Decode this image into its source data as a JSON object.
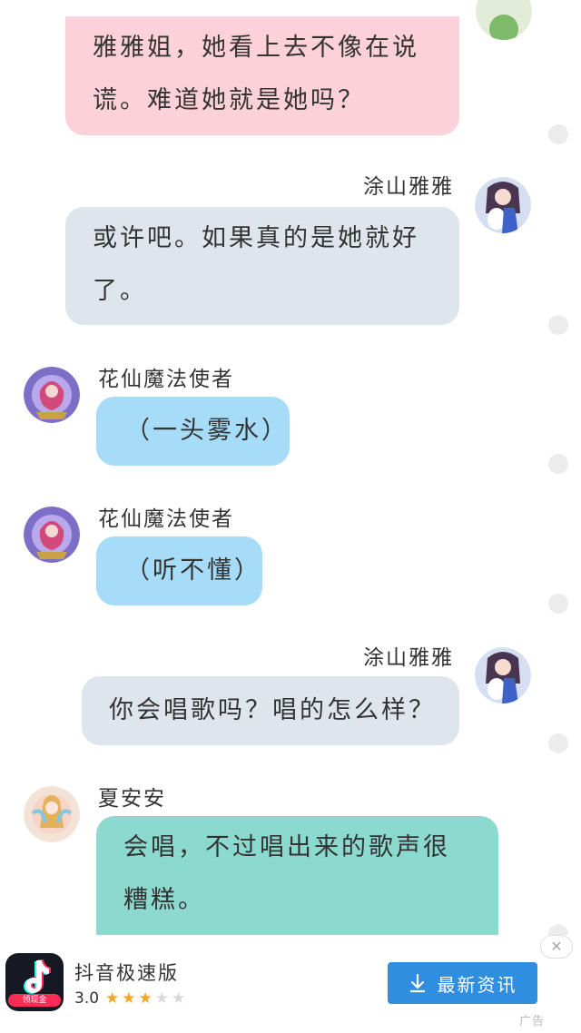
{
  "messages": [
    {
      "lines": [
        "雅雅姐，她看上去不像在说",
        "谎。难道她就是她吗？"
      ]
    },
    {
      "name": "涂山雅雅",
      "lines": [
        "或许吧。如果真的是她就好",
        "了。"
      ]
    },
    {
      "name": "花仙魔法使者",
      "lines": [
        "（一头雾水）"
      ]
    },
    {
      "name": "花仙魔法使者",
      "lines": [
        "（听不懂）"
      ]
    },
    {
      "name": "涂山雅雅",
      "lines": [
        "你会唱歌吗？唱的怎么样？"
      ]
    },
    {
      "name": "夏安安",
      "lines": [
        "会唱，不过唱出来的歌声很",
        "糟糕。"
      ]
    }
  ],
  "ad": {
    "app_name": "抖音极速版",
    "icon_badge": "领现金",
    "rating": "3.0",
    "stars_filled": 3,
    "stars_total": 5,
    "button_label": "最新资讯",
    "ad_label": "广告",
    "close_symbol": "✕"
  },
  "colors": {
    "pink_bubble": "#fcd1da",
    "grey_bubble": "#dfe5ec",
    "blue_bubble": "#a6dcf7",
    "teal_bubble": "#8bd9cf",
    "ad_button": "#2f8ee0",
    "star_on": "#f5a623"
  }
}
